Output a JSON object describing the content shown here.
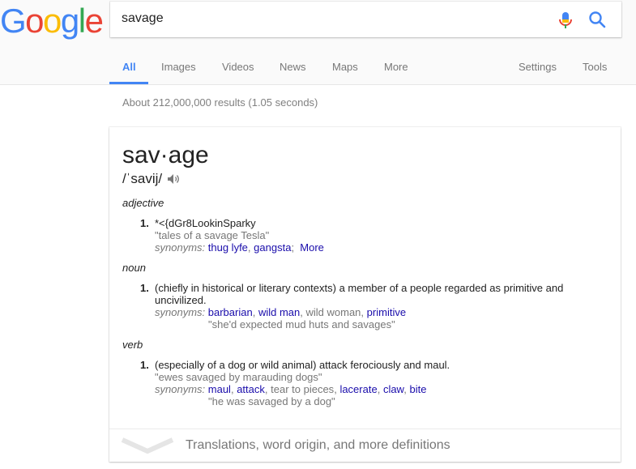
{
  "logo": [
    "G",
    "o",
    "o",
    "g",
    "l",
    "e"
  ],
  "search": {
    "value": "savage"
  },
  "tabs": [
    "All",
    "Images",
    "Videos",
    "News",
    "Maps",
    "More",
    "Settings",
    "Tools"
  ],
  "stats": "About 212,000,000 results (1.05 seconds)",
  "definition": {
    "word": "sav·age",
    "pronunciation": "/ˈsavij/",
    "adjective": {
      "pos": "adjective",
      "num": "1.",
      "text": "*<{dGr8LookinSparky",
      "example": "\"tales of a savage Tesla\"",
      "syn_label": "synonyms:",
      "syn1": "thug lyfe",
      "syn2": "gangsta",
      "syn_more": "More"
    },
    "noun": {
      "pos": "noun",
      "num": "1.",
      "text": "(chiefly in historical or literary contexts) a member of a people regarded as primitive and uncivilized.",
      "syn_label": "synonyms:",
      "syn1": "barbarian",
      "syn2": "wild man",
      "syn3": "wild woman",
      "syn4": "primitive",
      "example": "\"she'd expected mud huts and savages\""
    },
    "verb": {
      "pos": "verb",
      "num": "1.",
      "text": "(especially of a dog or wild animal) attack ferociously and maul.",
      "example1": "\"ewes savaged by marauding dogs\"",
      "syn_label": "synonyms:",
      "syn1": "maul",
      "syn2": "attack",
      "syn3": "tear to pieces",
      "syn4": "lacerate",
      "syn5": "claw",
      "syn6": "bite",
      "example2": "\"he was savaged by a dog\""
    },
    "more_defs": "Translations, word origin, and more definitions"
  },
  "colors": {
    "link": "#1a0dab",
    "tab_active": "#4285f4",
    "muted": "#777777"
  },
  "icons": [
    "microphone-icon",
    "search-icon",
    "speaker-icon",
    "chevron-down-icon"
  ]
}
